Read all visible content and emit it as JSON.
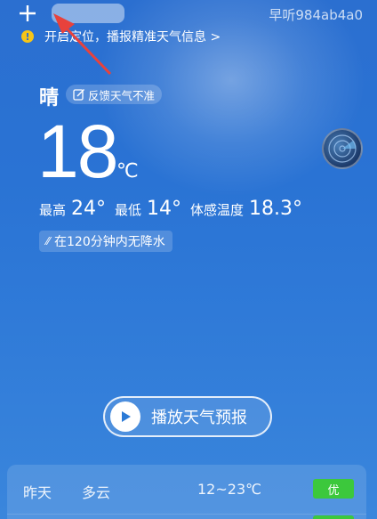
{
  "topbar": {
    "account_id": "早听984ab4a0"
  },
  "location_tip": {
    "text": "开启定位，播报精准天气信息 >"
  },
  "current": {
    "condition": "晴",
    "feedback_label": "反馈天气不准",
    "temperature": "18",
    "unit": "℃",
    "high_label": "最高",
    "high_value": "24°",
    "low_label": "最低",
    "low_value": "14°",
    "feels_label": "体感温度",
    "feels_value": "18.3°",
    "rain_forecast": "在120分钟内无降水"
  },
  "play_button": {
    "label": "播放天气预报"
  },
  "forecast": [
    {
      "day": "昨天",
      "condition": "多云",
      "temp_range": "12~23℃",
      "aqi": "优"
    }
  ],
  "colors": {
    "background": "#2b6fd0",
    "aqi_good": "#3cc83c",
    "warning": "#f5c518",
    "annotation_arrow": "#e8423c"
  },
  "icons": {
    "add": "plus-icon",
    "warning": "warning-icon",
    "feedback": "edit-icon",
    "radar": "radar-icon",
    "rain": "no-rain-icon",
    "play": "play-icon"
  }
}
